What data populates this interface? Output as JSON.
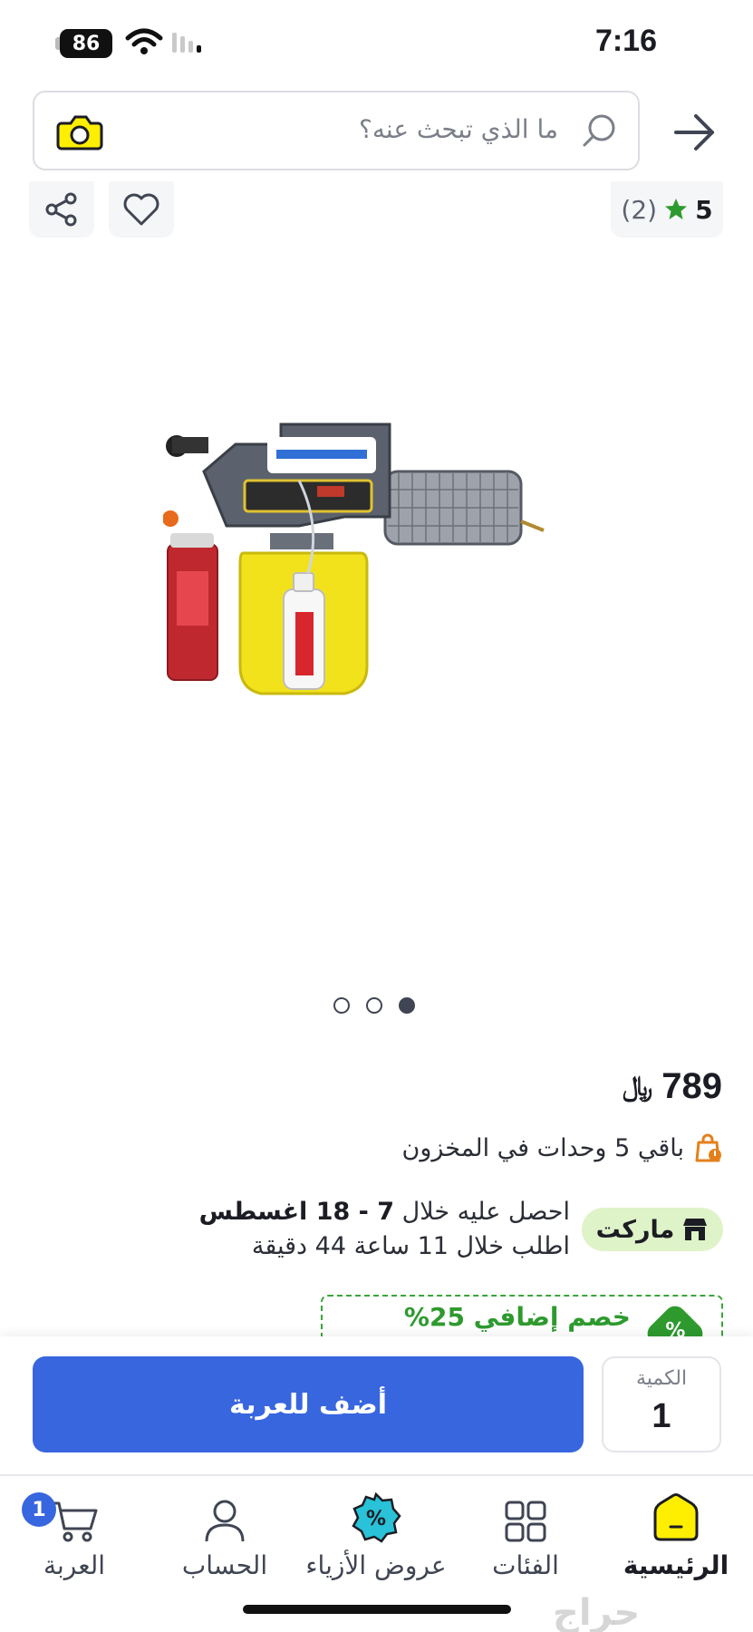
{
  "status_bar": {
    "battery": "86",
    "time": "7:16"
  },
  "search": {
    "placeholder": "ما الذي تبحث عنه؟"
  },
  "rating": {
    "value": "5",
    "count": "(2)"
  },
  "gallery": {
    "dots": 3,
    "active_index": 2
  },
  "product": {
    "price": "789",
    "currency": "﷼",
    "stock_text": "باقي 5 وحدات في المخزون"
  },
  "delivery": {
    "market_label": "ماركت",
    "get_prefix": "احصل عليه خلال ",
    "date_range": "7 - 18 اغسطس",
    "order_within": "اطلب خلال 11 ساعة 44 دقيقة"
  },
  "promo": {
    "text": "خصم إضافي 25%",
    "icon": "%"
  },
  "cart_bar": {
    "add_label": "أضف للعربة",
    "qty_label": "الكمية",
    "qty_value": "1"
  },
  "nav": {
    "home": "الرئيسية",
    "categories": "الفئات",
    "fashion_deals": "عروض الأزياء",
    "account": "الحساب",
    "cart": "العربة",
    "cart_badge": "1"
  },
  "watermark": "حراج",
  "colors": {
    "primary_blue": "#3866df",
    "brand_yellow": "#feee00",
    "promo_green": "#2e9a2e",
    "market_bg": "#dff3c8",
    "star_green": "#2e9a2e"
  }
}
